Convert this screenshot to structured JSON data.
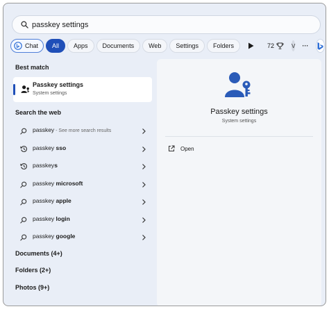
{
  "search": {
    "value": "passkey settings"
  },
  "filters": {
    "chat": "Chat",
    "all": "All",
    "apps": "Apps",
    "documents": "Documents",
    "web": "Web",
    "settings": "Settings",
    "folders": "Folders",
    "points": "72",
    "avatar": "V",
    "more": "···"
  },
  "left": {
    "best_match_header": "Best match",
    "best_match": {
      "title": "Passkey settings",
      "subtitle": "System settings"
    },
    "search_web_header": "Search the web",
    "web_results": [
      {
        "prefix": "passkey",
        "bold": "",
        "suffix": " - See more search results",
        "icon": "search-icon"
      },
      {
        "prefix": "passkey ",
        "bold": "sso",
        "suffix": "",
        "icon": "history-icon"
      },
      {
        "prefix": "passkey",
        "bold": "s",
        "suffix": "",
        "icon": "history-icon"
      },
      {
        "prefix": "passkey ",
        "bold": "microsoft",
        "suffix": "",
        "icon": "search-icon"
      },
      {
        "prefix": "passkey ",
        "bold": "apple",
        "suffix": "",
        "icon": "search-icon"
      },
      {
        "prefix": "passkey ",
        "bold": "login",
        "suffix": "",
        "icon": "search-icon"
      },
      {
        "prefix": "passkey ",
        "bold": "google",
        "suffix": "",
        "icon": "search-icon"
      }
    ],
    "documents_header": "Documents (4+)",
    "folders_header": "Folders (2+)",
    "photos_header": "Photos (9+)"
  },
  "right": {
    "title": "Passkey settings",
    "subtitle": "System settings",
    "open_label": "Open"
  },
  "colors": {
    "accent": "#1f4fb8",
    "hero_icon": "#2a5bb8",
    "panel": "#e9eef7"
  }
}
